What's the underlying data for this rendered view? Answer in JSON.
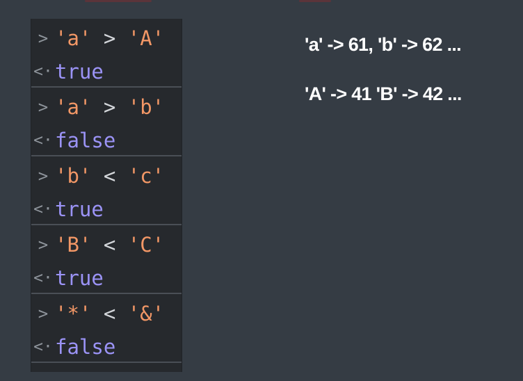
{
  "console": {
    "entries": [
      {
        "prompt": ">",
        "left": "'a'",
        "operator": ">",
        "right": "'A'",
        "result_prompt": "<·",
        "result": "true"
      },
      {
        "prompt": ">",
        "left": "'a'",
        "operator": ">",
        "right": "'b'",
        "result_prompt": "<·",
        "result": "false"
      },
      {
        "prompt": ">",
        "left": "'b'",
        "operator": "<",
        "right": "'c'",
        "result_prompt": "<·",
        "result": "true"
      },
      {
        "prompt": ">",
        "left": "'B'",
        "operator": "<",
        "right": "'C'",
        "result_prompt": "<·",
        "result": "true"
      },
      {
        "prompt": ">",
        "left": "'*'",
        "operator": "<",
        "right": "'&'",
        "result_prompt": "<·",
        "result": "false"
      }
    ]
  },
  "notes": {
    "line1": "'a' -> 61, 'b' -> 62 ...",
    "line2": "'A' -> 41 'B' -> 42 ..."
  },
  "colors": {
    "background": "#353c44",
    "console_background": "#26292d",
    "string": "#f29766",
    "boolean": "#9b93f6",
    "operator": "#d3d6da",
    "prompt": "#8e949b",
    "note_text": "#ffffff"
  }
}
